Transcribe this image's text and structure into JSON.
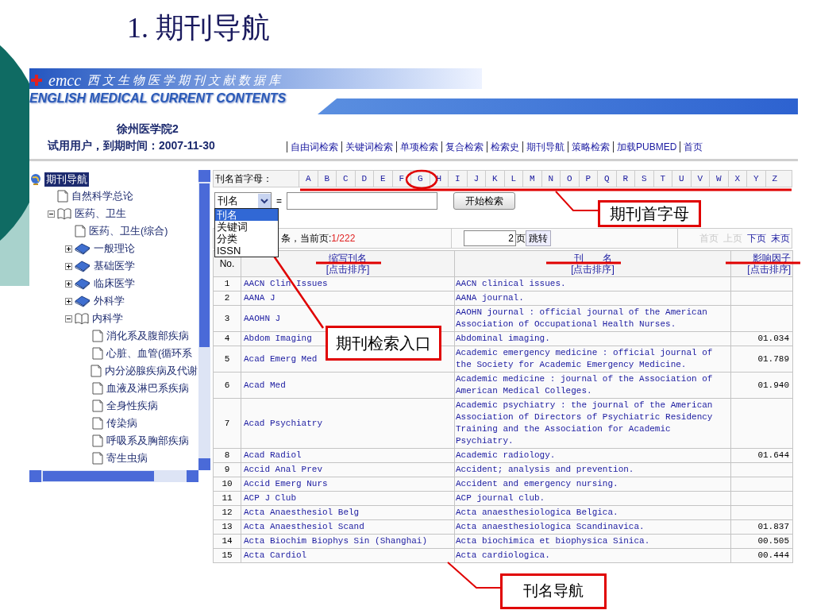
{
  "slide_title": "1. 期刊导航",
  "banner": {
    "logo": "emcc",
    "logo_cn": "西文生物医学期刊文献数据库",
    "subtitle": "ENGLISH MEDICAL CURRENT CONTENTS"
  },
  "user": {
    "institution": "徐州医学院2",
    "account": "试用用户，到期时间：2007-11-30"
  },
  "nav_links": [
    "自由词检索",
    "关键词检索",
    "单项检索",
    "复合检索",
    "检索史",
    "期刊导航",
    "策略检索",
    "加载PUBMED",
    "首页"
  ],
  "tree": {
    "label": "期刊导航",
    "selected": true,
    "children": [
      {
        "label": "自然科学总论",
        "kind": "page",
        "selected": false
      },
      {
        "label": "医药、卫生",
        "kind": "book",
        "expanded": true,
        "selected": false,
        "children": [
          {
            "label": "医药、卫生(综合)",
            "kind": "page",
            "selected": false
          },
          {
            "label": "一般理论",
            "kind": "book",
            "expanded": false,
            "selected": false
          },
          {
            "label": "基础医学",
            "kind": "book",
            "expanded": false,
            "selected": false
          },
          {
            "label": "临床医学",
            "kind": "book",
            "expanded": false,
            "selected": false
          },
          {
            "label": "外科学",
            "kind": "book",
            "expanded": false,
            "selected": false
          },
          {
            "label": "内科学",
            "kind": "book",
            "expanded": true,
            "selected": false,
            "children": [
              {
                "label": "消化系及腹部疾病",
                "kind": "page",
                "selected": false
              },
              {
                "label": "心脏、血管(循环系",
                "kind": "page",
                "selected": false
              },
              {
                "label": "内分泌腺疾病及代谢",
                "kind": "page",
                "selected": false
              },
              {
                "label": "血液及淋巴系疾病",
                "kind": "page",
                "selected": false
              },
              {
                "label": "全身性疾病",
                "kind": "page",
                "selected": false
              },
              {
                "label": "传染病",
                "kind": "page",
                "selected": false
              },
              {
                "label": "呼吸系及胸部疾病",
                "kind": "page",
                "selected": false
              },
              {
                "label": "寄生虫病",
                "kind": "page",
                "selected": false
              }
            ]
          }
        ]
      }
    ]
  },
  "letter_bar": {
    "label": "刊名首字母：",
    "letters": [
      "A",
      "B",
      "C",
      "D",
      "E",
      "F",
      "G",
      "H",
      "I",
      "J",
      "K",
      "L",
      "M",
      "N",
      "O",
      "P",
      "Q",
      "R",
      "S",
      "T",
      "U",
      "V",
      "W",
      "X",
      "Y",
      "Z"
    ]
  },
  "search": {
    "field": "刊名",
    "equals": "=",
    "button": "开始检索",
    "options": [
      {
        "label": "刊名",
        "selected": true
      },
      {
        "label": "关键词",
        "selected": false
      },
      {
        "label": "分类",
        "selected": false
      },
      {
        "label": "ISSN",
        "selected": false
      }
    ]
  },
  "pager": {
    "status": "条，当前页:",
    "page": "1/222",
    "page_input": "2",
    "page_unit": "页",
    "go": "跳转",
    "links": [
      {
        "label": "首页",
        "disabled": true
      },
      {
        "label": "上页",
        "disabled": true
      },
      {
        "label": "下页",
        "disabled": false
      },
      {
        "label": "末页",
        "disabled": false
      }
    ]
  },
  "table": {
    "columns": [
      {
        "label": "No."
      },
      {
        "label": "缩写刊名",
        "sort": "[点击排序]"
      },
      {
        "label": "刊　　名",
        "sort": "[点击排序]"
      },
      {
        "label": "影响因子",
        "sort": "[点击排序]"
      }
    ],
    "rows": [
      {
        "no": "1",
        "abbr": "AACN Clin Issues",
        "title": "AACN clinical issues."
      },
      {
        "no": "2",
        "abbr": "AANA J",
        "title": "AANA journal."
      },
      {
        "no": "3",
        "abbr": "AAOHN J",
        "title": "AAOHN journal : official journal of the American Association of Occupational Health Nurses."
      },
      {
        "no": "4",
        "abbr": "Abdom Imaging",
        "title": "Abdominal imaging.",
        "factor": "01.034"
      },
      {
        "no": "5",
        "abbr": "Acad Emerg Med",
        "title": "Academic emergency medicine : official journal of the Society for Academic Emergency Medicine.",
        "factor": "01.789"
      },
      {
        "no": "6",
        "abbr": "Acad Med",
        "title": "Academic medicine : journal of the Association of American Medical Colleges.",
        "factor": "01.940"
      },
      {
        "no": "7",
        "abbr": "Acad Psychiatry",
        "title": "Academic psychiatry : the journal of the American Association of Directors of Psychiatric Residency Training and the Association for Academic Psychiatry."
      },
      {
        "no": "8",
        "abbr": "Acad Radiol",
        "title": "Academic radiology.",
        "factor": "01.644"
      },
      {
        "no": "9",
        "abbr": "Accid Anal Prev",
        "title": "Accident; analysis and prevention."
      },
      {
        "no": "10",
        "abbr": "Accid Emerg Nurs",
        "title": "Accident and emergency nursing."
      },
      {
        "no": "11",
        "abbr": "ACP J Club",
        "title": "ACP journal club."
      },
      {
        "no": "12",
        "abbr": "Acta Anaesthesiol Belg",
        "title": "Acta anaesthesiologica Belgica."
      },
      {
        "no": "13",
        "abbr": "Acta Anaesthesiol Scand",
        "title": "Acta anaesthesiologica Scandinavica.",
        "factor": "01.837"
      },
      {
        "no": "14",
        "abbr": "Acta Biochim Biophys Sin (Shanghai)",
        "title": "Acta biochimica et biophysica Sinica.",
        "factor": "00.505"
      },
      {
        "no": "15",
        "abbr": "Acta Cardiol",
        "title": "Acta cardiologica.",
        "factor": "00.444"
      }
    ]
  },
  "callouts": [
    "期刊首字母",
    "期刊检索入口",
    "刊名导航"
  ]
}
